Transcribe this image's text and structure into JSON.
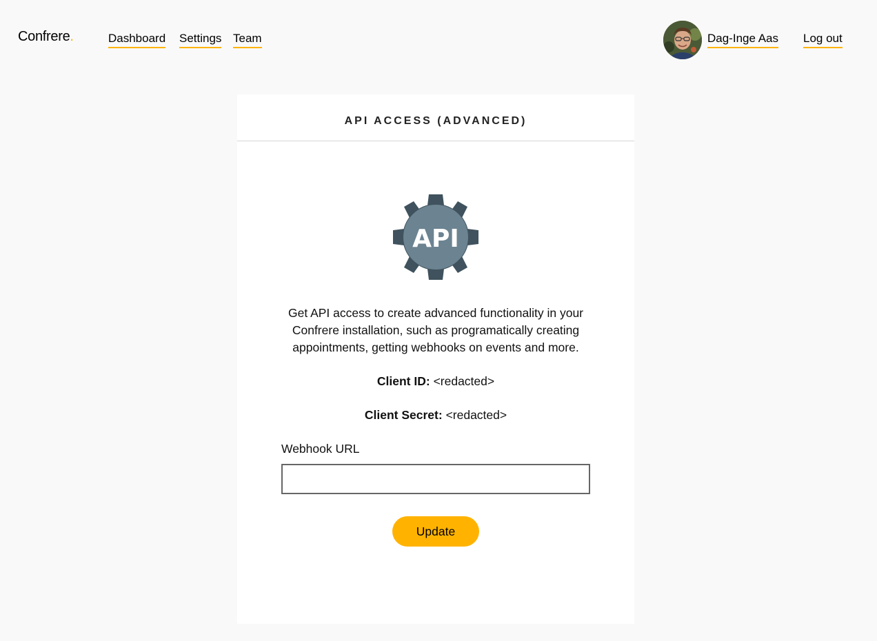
{
  "app": {
    "logo_text": "Confrere",
    "logo_dot": "."
  },
  "nav": {
    "dashboard": "Dashboard",
    "settings": "Settings",
    "team": "Team",
    "user_name": "Dag-Inge Aas",
    "logout": "Log out"
  },
  "card": {
    "title": "API ACCESS (ADVANCED)",
    "icon_text": "API",
    "description": "Get API access to create advanced functionality in your Confrere installation, such as programatically creating appointments, getting webhooks on events and more.",
    "client_id_label": "Client ID:",
    "client_id_value": "<redacted>",
    "client_secret_label": "Client Secret:",
    "client_secret_value": "<redacted>",
    "webhook_label": "Webhook URL",
    "webhook_value": "",
    "update_button": "Update"
  },
  "colors": {
    "accent": "#ffb300",
    "background": "#f9f9f9",
    "card": "#ffffff",
    "gear_dark": "#3f525d",
    "gear_light": "#6c8391"
  },
  "icons": {
    "settings": "gear-icon",
    "user": "avatar"
  }
}
